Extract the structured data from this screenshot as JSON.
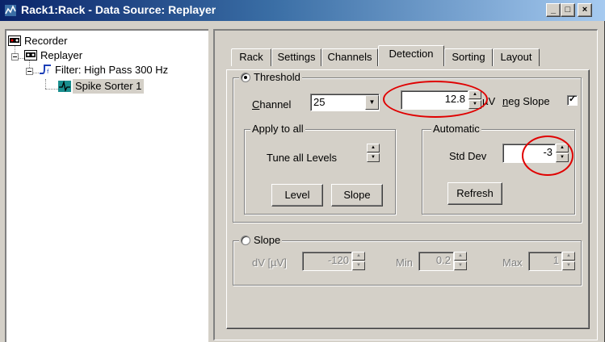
{
  "window": {
    "title": "Rack1:Rack - Data Source: Replayer",
    "caption_buttons": {
      "minimize": "_",
      "maximize": "□",
      "close": "×"
    }
  },
  "tree": {
    "items": [
      {
        "label": "Recorder",
        "icon": "recorder-icon"
      },
      {
        "label": "Replayer",
        "icon": "replayer-icon"
      },
      {
        "label": "Filter: High Pass 300 Hz",
        "icon": "filter-icon"
      },
      {
        "label": "Spike Sorter 1",
        "icon": "spike-sorter-icon",
        "selected": true
      }
    ]
  },
  "tabs": [
    {
      "label": "Rack"
    },
    {
      "label": "Settings"
    },
    {
      "label": "Channels"
    },
    {
      "label": "Detection",
      "active": true
    },
    {
      "label": "Sorting"
    },
    {
      "label": "Layout"
    }
  ],
  "threshold": {
    "title": "Threshold",
    "selected": true,
    "channel_label": "Channel",
    "channel_value": "25",
    "level_value": "12.8",
    "level_unit": "µV",
    "neg_slope_label": "neg Slope",
    "neg_slope_checked": true,
    "apply_all": {
      "title": "Apply to all",
      "tune_label": "Tune all Levels",
      "level_button": "Level",
      "slope_button": "Slope"
    },
    "automatic": {
      "title": "Automatic",
      "std_dev_label": "Std Dev",
      "std_dev_value": "-3",
      "refresh_button": "Refresh"
    }
  },
  "slope": {
    "title": "Slope",
    "selected": false,
    "dv_label": "dV [µV]",
    "dv_value": "-120",
    "min_label": "Min",
    "min_value": "0.2",
    "max_label": "Max",
    "max_value": "1"
  },
  "colors": {
    "highlight_circle": "#e00000",
    "title_bar": "#0a246a",
    "face": "#d4d0c8"
  }
}
